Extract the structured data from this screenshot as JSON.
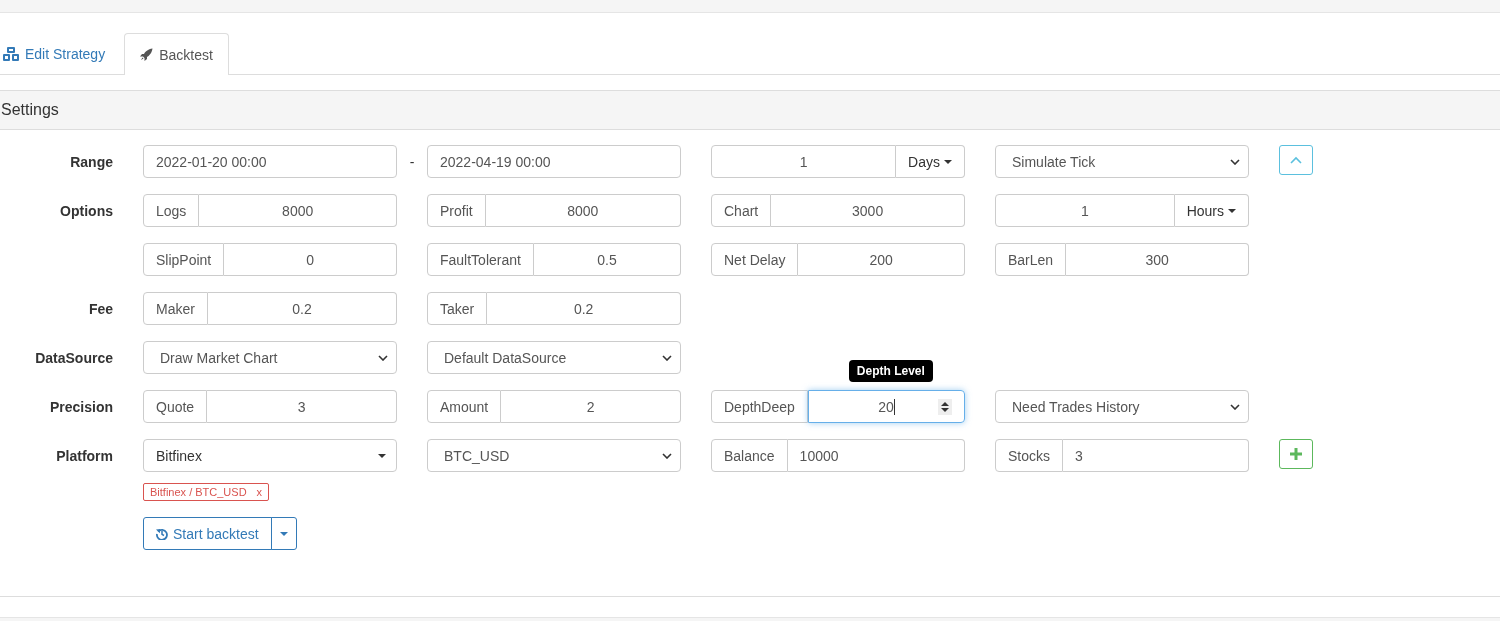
{
  "tabs": [
    {
      "label": "Edit Strategy",
      "selected": false
    },
    {
      "label": "Backtest",
      "selected": true
    }
  ],
  "panel": {
    "title": "Settings"
  },
  "rows": [
    {
      "label": "Range",
      "cells": [
        {
          "kind": "text",
          "value": "2022-01-20 00:00"
        },
        {
          "kind": "separator",
          "text": "-"
        },
        {
          "kind": "text",
          "value": "2022-04-19 00:00"
        },
        {
          "kind": "unit",
          "value": "1",
          "unit": "Days"
        },
        {
          "kind": "select",
          "value": "Simulate Tick"
        },
        {
          "kind": "collapse-button"
        }
      ]
    },
    {
      "label": "Options",
      "cells": [
        {
          "kind": "addon",
          "addon": "Logs",
          "value": "8000"
        },
        {
          "kind": "addon",
          "addon": "Profit",
          "value": "8000"
        },
        {
          "kind": "addon",
          "addon": "Chart",
          "value": "3000"
        },
        {
          "kind": "unit",
          "value": "1",
          "unit": "Hours"
        }
      ]
    },
    {
      "cells": [
        {
          "kind": "addon",
          "addon": "SlipPoint",
          "value": "0"
        },
        {
          "kind": "addon",
          "addon": "FaultTolerant",
          "value": "0.5"
        },
        {
          "kind": "addon",
          "addon": "Net Delay",
          "value": "200"
        },
        {
          "kind": "addon",
          "addon": "BarLen",
          "value": "300"
        }
      ]
    },
    {
      "label": "Fee",
      "cells": [
        {
          "kind": "addon",
          "addon": "Maker",
          "value": "0.2"
        },
        {
          "kind": "addon",
          "addon": "Taker",
          "value": "0.2"
        }
      ]
    },
    {
      "label": "DataSource",
      "cells": [
        {
          "kind": "select",
          "value": "Draw Market Chart"
        },
        {
          "kind": "select",
          "value": "Default DataSource"
        }
      ]
    },
    {
      "label": "Precision",
      "cells": [
        {
          "kind": "addon",
          "addon": "Quote",
          "value": "3"
        },
        {
          "kind": "addon",
          "addon": "Amount",
          "value": "2"
        },
        {
          "kind": "addon",
          "addon": "DepthDeep",
          "value": "20",
          "focused": true,
          "spinner": true,
          "tooltip": "Depth Level"
        },
        {
          "kind": "select",
          "value": "Need Trades History"
        }
      ]
    },
    {
      "label": "Platform",
      "cells": [
        {
          "kind": "dropdown",
          "value": "Bitfinex"
        },
        {
          "kind": "select",
          "value": "BTC_USD"
        },
        {
          "kind": "addon-left",
          "addon": "Balance",
          "value": "10000"
        },
        {
          "kind": "addon-left",
          "addon": "Stocks",
          "value": "3"
        },
        {
          "kind": "add-button"
        }
      ]
    }
  ],
  "tags": [
    {
      "label": "Bitfinex / BTC_USD",
      "remove": "x"
    }
  ],
  "action": {
    "label": "Start backtest"
  }
}
